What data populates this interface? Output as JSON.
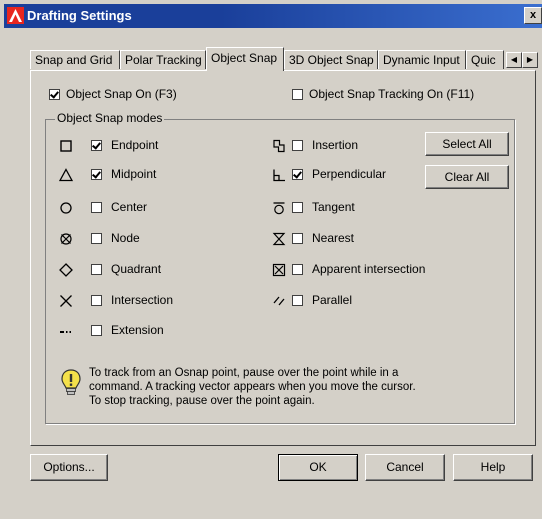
{
  "window": {
    "title": "Drafting Settings",
    "close_label": "x"
  },
  "tabs": [
    {
      "label": "Snap and Grid",
      "active": false
    },
    {
      "label": "Polar Tracking",
      "active": false
    },
    {
      "label": "Object Snap",
      "active": true
    },
    {
      "label": "3D Object Snap",
      "active": false
    },
    {
      "label": "Dynamic Input",
      "active": false
    },
    {
      "label": "Quic",
      "active": false
    }
  ],
  "tab_scroll": {
    "left": "◀",
    "right": "▶"
  },
  "options": {
    "osnap_on": {
      "label": "Object Snap On (F3)",
      "checked": true
    },
    "osnap_tracking": {
      "label": "Object Snap Tracking On (F11)",
      "checked": false
    }
  },
  "modes_group": {
    "title": "Object Snap modes",
    "left": [
      {
        "label": "Endpoint",
        "checked": true,
        "icon": "endpoint-icon"
      },
      {
        "label": "Midpoint",
        "checked": true,
        "icon": "midpoint-icon"
      },
      {
        "label": "Center",
        "checked": false,
        "icon": "center-icon"
      },
      {
        "label": "Node",
        "checked": false,
        "icon": "node-icon"
      },
      {
        "label": "Quadrant",
        "checked": false,
        "icon": "quadrant-icon"
      },
      {
        "label": "Intersection",
        "checked": false,
        "icon": "intersection-icon"
      },
      {
        "label": "Extension",
        "checked": false,
        "icon": "extension-icon"
      }
    ],
    "right": [
      {
        "label": "Insertion",
        "checked": false,
        "icon": "insertion-icon"
      },
      {
        "label": "Perpendicular",
        "checked": true,
        "icon": "perpendicular-icon"
      },
      {
        "label": "Tangent",
        "checked": false,
        "icon": "tangent-icon"
      },
      {
        "label": "Nearest",
        "checked": false,
        "icon": "nearest-icon"
      },
      {
        "label": "Apparent intersection",
        "checked": false,
        "icon": "apparent-intersection-icon"
      },
      {
        "label": "Parallel",
        "checked": false,
        "icon": "parallel-icon"
      }
    ],
    "select_all": "Select All",
    "clear_all": "Clear All"
  },
  "hint": {
    "lines": [
      "To track from an Osnap point, pause over the point while in a",
      "command.  A tracking vector appears when you move the cursor.",
      "To stop tracking, pause over the point again."
    ]
  },
  "footer": {
    "options": "Options...",
    "ok": "OK",
    "cancel": "Cancel",
    "help": "Help"
  },
  "colors": {
    "face": "#d4d0c8",
    "title_bar": "#1a3f9a",
    "app_icon": "#e8261f"
  }
}
